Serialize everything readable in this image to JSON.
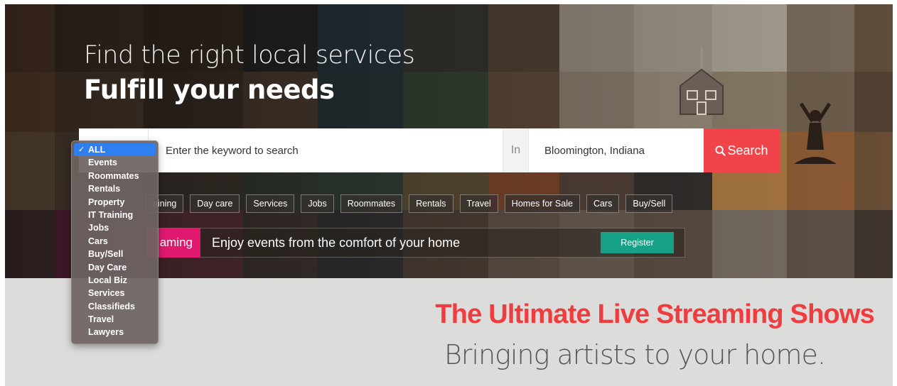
{
  "hero": {
    "headline_line1": "Find the right local services",
    "headline_line2": "Fulfill your needs"
  },
  "search": {
    "keyword_placeholder": "Enter the keyword to search",
    "in_label": "In",
    "location_value": "Bloomington, Indiana",
    "button_label": "Search",
    "button_icon": "search-icon",
    "button_color": "#f0434a"
  },
  "chips": [
    "aining",
    "Day care",
    "Services",
    "Jobs",
    "Roommates",
    "Rentals",
    "Travel",
    "Homes for Sale",
    "Cars",
    "Buy/Sell"
  ],
  "promo": {
    "tag_label": "aming",
    "tag_color": "#e0196e",
    "text": "Enjoy events from the comfort of your home",
    "register_label": "Register",
    "register_color": "#16a085"
  },
  "banner": {
    "title": "The Ultimate Live Streaming Shows",
    "subtitle": "Bringing artists to your home.",
    "title_color": "#ef3c3e"
  },
  "category_dropdown": {
    "selected_index": 0,
    "check_glyph": "✓",
    "options": [
      "ALL",
      "Events",
      "Roommates",
      "Rentals",
      "Property",
      "IT Training",
      "Jobs",
      "Cars",
      "Buy/Sell",
      "Day Care",
      "Local Biz",
      "Services",
      "Classifieds",
      "Travel",
      "Lawyers"
    ]
  }
}
